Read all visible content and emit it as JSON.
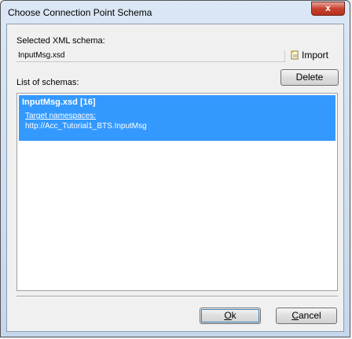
{
  "window": {
    "title": "Choose Connection Point Schema",
    "close_glyph": "x"
  },
  "schema": {
    "selected_label": "Selected XML schema:",
    "selected_value": "InputMsg.xsd",
    "import_label": "Import",
    "list_label": "List of schemas:",
    "delete_label": "Delete"
  },
  "list": {
    "items": [
      {
        "name": "InputMsg.xsd [16]",
        "namespace_label": "Target namespaces:",
        "namespace_value": "http://Acc_Tutorial1_BTS.InputMsg"
      }
    ],
    "selected_color": "#3399ff"
  },
  "footer": {
    "ok_accel": "O",
    "ok_rest": "k",
    "cancel_accel": "C",
    "cancel_rest": "ancel"
  }
}
